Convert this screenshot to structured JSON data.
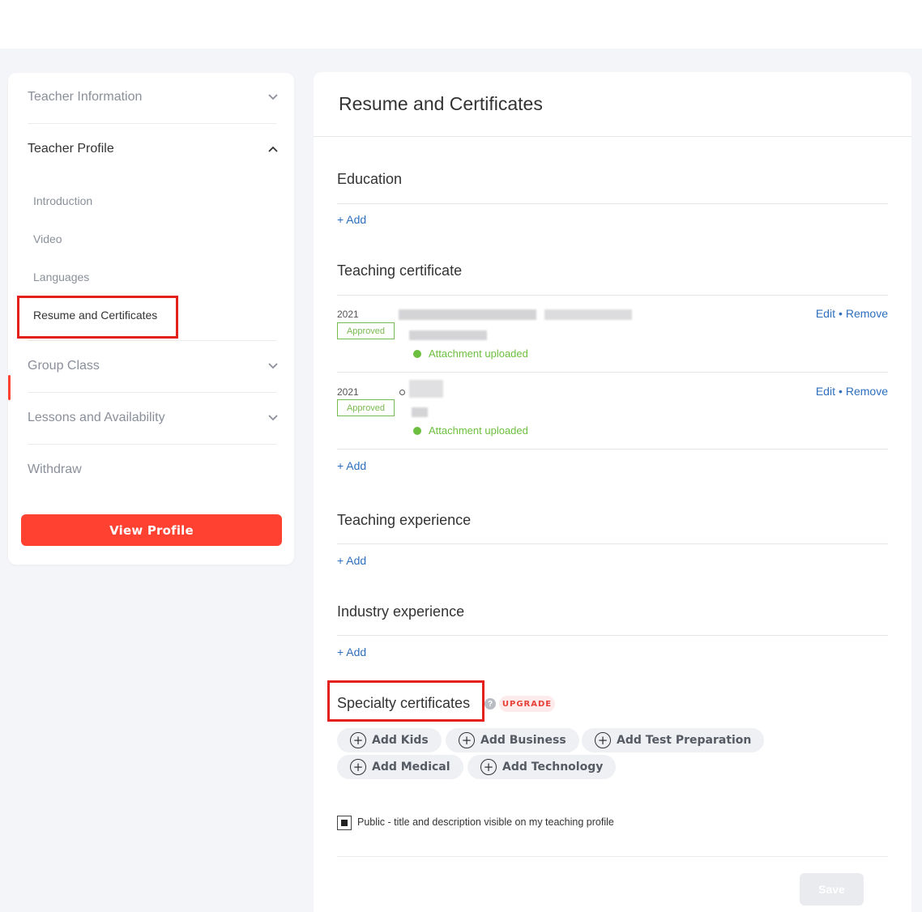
{
  "sidebar": {
    "sections": [
      {
        "label": "Teacher Information"
      },
      {
        "label": "Teacher Profile"
      },
      {
        "label": "Group Class"
      },
      {
        "label": "Lessons and Availability"
      },
      {
        "label": "Withdraw"
      }
    ],
    "sub_items": [
      {
        "label": "Introduction"
      },
      {
        "label": "Video"
      },
      {
        "label": "Languages"
      },
      {
        "label": "Resume and Certificates"
      }
    ],
    "view_profile_label": "View Profile"
  },
  "main": {
    "title": "Resume and Certificates",
    "education": {
      "title": "Education",
      "add_label": "+ Add"
    },
    "teaching_certificate": {
      "title": "Teaching certificate",
      "add_label": "+ Add",
      "items": [
        {
          "year": "2021",
          "status": "Approved",
          "attachment": "Attachment uploaded",
          "edit": "Edit",
          "sep": "•",
          "remove": "Remove"
        },
        {
          "year": "2021",
          "status": "Approved",
          "attachment": "Attachment uploaded",
          "edit": "Edit",
          "sep": "•",
          "remove": "Remove"
        }
      ]
    },
    "teaching_experience": {
      "title": "Teaching experience",
      "add_label": "+ Add"
    },
    "industry_experience": {
      "title": "Industry experience",
      "add_label": "+ Add"
    },
    "specialty": {
      "title": "Specialty certificates",
      "help": "?",
      "upgrade": "UPGRADE",
      "chips": [
        {
          "label": "Add Kids"
        },
        {
          "label": "Add Business"
        },
        {
          "label": "Add Test Preparation"
        },
        {
          "label": "Add Medical"
        },
        {
          "label": "Add Technology"
        }
      ]
    },
    "public_checkbox": {
      "label": "Public - title and description visible on my teaching profile",
      "checked": true
    },
    "save_label": "Save"
  },
  "colors": {
    "accent": "#ff4132",
    "link": "#2f6fbd",
    "approved": "#78bb4f",
    "highlight": "#e3201b"
  },
  "icons": {
    "collapse": "chevron-down-icon",
    "expand": "chevron-up-icon",
    "chip": "plus-circle-icon",
    "help": "question-icon",
    "attachment": "status-dot-icon"
  }
}
